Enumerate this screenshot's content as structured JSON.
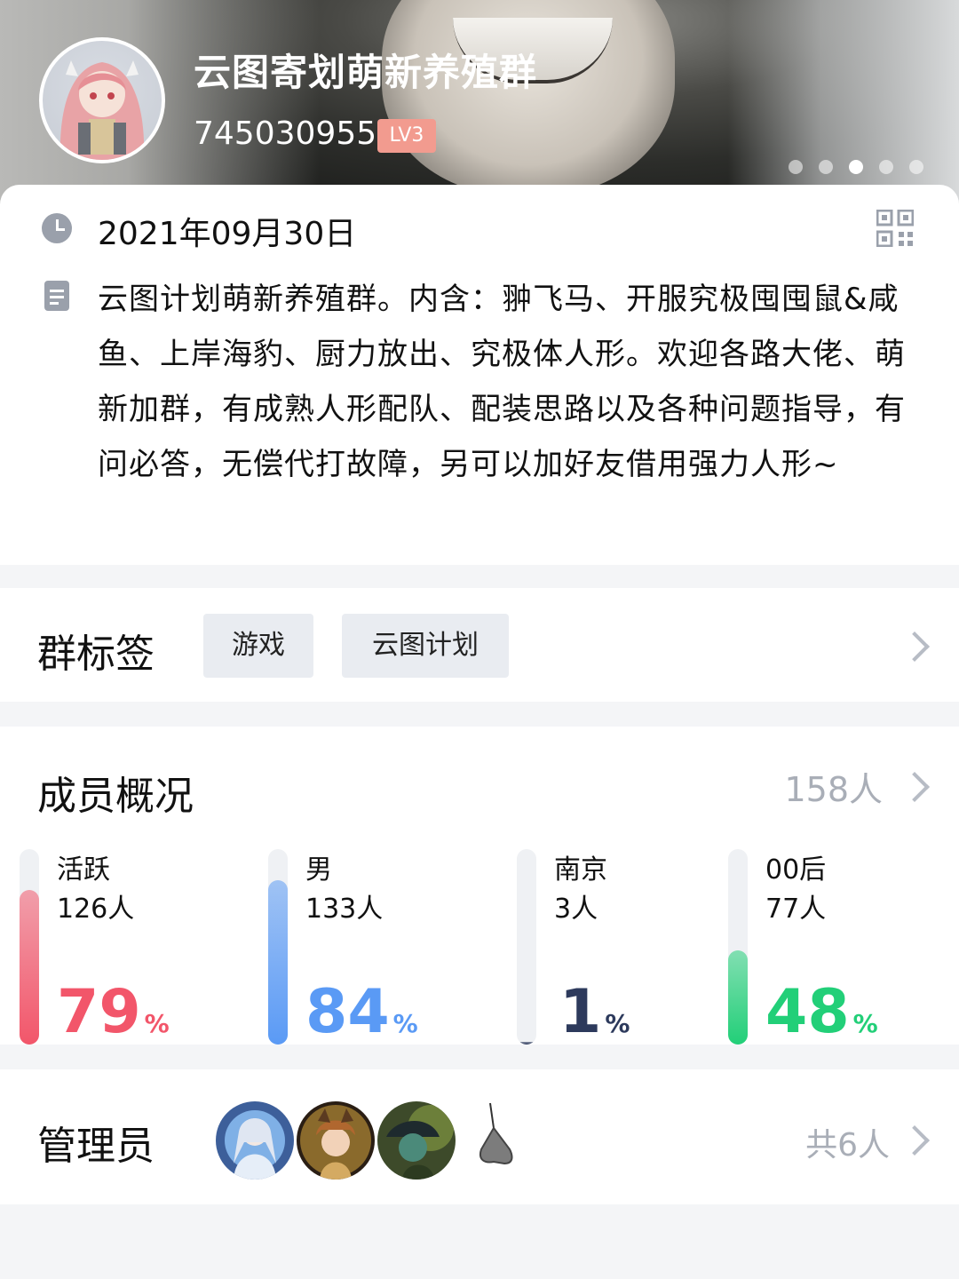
{
  "header": {
    "group_name": "云图寄划萌新养殖群",
    "group_id": "745030955",
    "level": "LV3",
    "carousel_total": 5,
    "carousel_active_index": 2
  },
  "info": {
    "date": "2021年09月30日",
    "description": "云图计划萌新养殖群。内含：翀飞马、开服究极囤囤鼠&咸鱼、上岸海豹、厨力放出、究极体人形。欢迎各路大佬、萌新加群，有成熟人形配队、配装思路以及各种问题指导，有问必答，无偿代打故障，另可以加好友借用强力人形~"
  },
  "tags": {
    "title": "群标签",
    "items": [
      "游戏",
      "云图计划"
    ]
  },
  "members": {
    "title": "成员概况",
    "total": "158人",
    "stats": [
      {
        "label": "活跃",
        "count": "126人",
        "percent": "79",
        "unit": "%",
        "fill": 0.79,
        "color": "#f2566a"
      },
      {
        "label": "男",
        "count": "133人",
        "percent": "84",
        "unit": "%",
        "fill": 0.84,
        "color": "#5a9af5"
      },
      {
        "label": "南京",
        "count": "3人",
        "percent": "1",
        "unit": "%",
        "fill": 0.01,
        "color": "#2d3a5c"
      },
      {
        "label": "00后",
        "count": "77人",
        "percent": "48",
        "unit": "%",
        "fill": 0.48,
        "color": "#22cf78"
      }
    ]
  },
  "admins": {
    "title": "管理员",
    "total": "共6人"
  },
  "colors": {
    "level_badge": "#f29b8f",
    "muted_text": "#a9aeb7",
    "tag_bg": "#e9ecf1"
  }
}
